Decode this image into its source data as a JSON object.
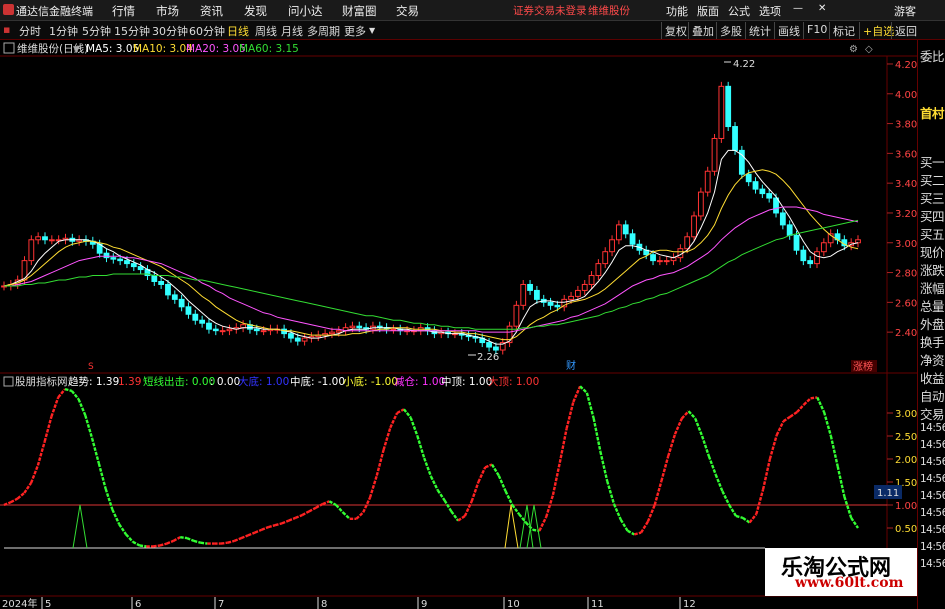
{
  "menubar": {
    "title": "通达信金融终端",
    "items": [
      "行情",
      "市场",
      "资讯",
      "发现",
      "问小达",
      "财富圈",
      "交易"
    ],
    "notice": "证券交易未登录",
    "stock": "维维股份",
    "right": [
      "功能",
      "版面",
      "公式",
      "选项"
    ],
    "user": "游客"
  },
  "toolbar": {
    "periods": [
      "分时",
      "1分钟",
      "5分钟",
      "15分钟",
      "30分钟",
      "60分钟",
      "日线",
      "周线",
      "月线",
      "多周期",
      "更多"
    ],
    "active_period": "日线",
    "buttons": [
      "复权",
      "叠加",
      "多股",
      "统计",
      "画线",
      "F10",
      "标记",
      "+自选",
      "返回"
    ]
  },
  "main_chart": {
    "stock_title": "维维股份(日线)",
    "ma": [
      {
        "label": "MA5: 3.05",
        "color": "#ffffff"
      },
      {
        "label": "MA10: 3.04",
        "color": "#ffdd33"
      },
      {
        "label": "MA20: 3.05",
        "color": "#ff55ff"
      },
      {
        "label": "MA60: 3.15",
        "color": "#33dd33"
      }
    ],
    "high_label": "4.22",
    "low_label": "2.26",
    "markers": [
      {
        "text": "S",
        "color": "#ff3333"
      },
      {
        "text": "财",
        "color": "#3399ff"
      },
      {
        "text": "涨榜",
        "color": "#ff5555"
      }
    ]
  },
  "indicator": {
    "name": "股朋指标网",
    "fields": [
      {
        "label": "趋势: 1.39",
        "color": "#ffffff"
      },
      {
        "label": "1.39",
        "color": "#ff3333"
      },
      {
        "label": "短线出击: 0.00",
        "color": "#33ff33"
      },
      {
        "label": ": 0.00",
        "color": "#ffffff"
      },
      {
        "label": "大底: 1.00",
        "color": "#3333ff"
      },
      {
        "label": "中底: -1.00",
        "color": "#ffffff"
      },
      {
        "label": "小底: -1.00",
        "color": "#ffff33"
      },
      {
        "label": "减仓: 1.00",
        "color": "#ff33ff"
      },
      {
        "label": "中顶: 1.00",
        "color": "#ffffff"
      },
      {
        "label": "大顶: 1.00",
        "color": "#ff3333"
      }
    ],
    "current_value": "1.11"
  },
  "date_axis": {
    "year_label": "2024年",
    "months": [
      "5",
      "6",
      "7",
      "8",
      "9",
      "10",
      "11",
      "12"
    ]
  },
  "sidebar": {
    "labels": [
      "委比",
      "首村",
      "买一",
      "买二",
      "买三",
      "买四",
      "买五",
      "现价",
      "涨跌",
      "涨幅",
      "总量",
      "外盘",
      "换手",
      "净资",
      "收益",
      "自动",
      "交易",
      "14:56",
      "14:56",
      "14:56",
      "14:56",
      "14:56",
      "14:56",
      "14:56",
      "14:56",
      "14:56"
    ]
  },
  "watermark": {
    "line1": "乐淘公式网",
    "line2": "www.60lt.com"
  },
  "chart_data": [
    {
      "type": "candlestick",
      "title": "维维股份(日线)",
      "ylim": [
        2.2,
        4.3
      ],
      "y_ticks": [
        4.2,
        4.0,
        3.8,
        3.6,
        3.4,
        3.2,
        3.0,
        2.8,
        2.6,
        2.4
      ],
      "y_tick_labels": [
        "4.20",
        "4.00",
        "3.80",
        "3.60",
        "3.40",
        "3.20",
        "3.00",
        "2.80",
        "2.60",
        "2.40"
      ],
      "close": [
        2.71,
        2.72,
        2.75,
        2.88,
        3.02,
        3.04,
        3.02,
        3.02,
        3.02,
        3.03,
        3.01,
        3.02,
        3.01,
        2.99,
        2.93,
        2.9,
        2.89,
        2.88,
        2.86,
        2.84,
        2.82,
        2.78,
        2.74,
        2.72,
        2.65,
        2.62,
        2.57,
        2.52,
        2.48,
        2.46,
        2.42,
        2.41,
        2.41,
        2.42,
        2.43,
        2.45,
        2.42,
        2.41,
        2.41,
        2.42,
        2.42,
        2.39,
        2.36,
        2.34,
        2.36,
        2.37,
        2.38,
        2.39,
        2.4,
        2.41,
        2.43,
        2.44,
        2.43,
        2.42,
        2.44,
        2.43,
        2.42,
        2.42,
        2.41,
        2.41,
        2.41,
        2.43,
        2.41,
        2.39,
        2.4,
        2.39,
        2.39,
        2.38,
        2.37,
        2.36,
        2.33,
        2.3,
        2.28,
        2.33,
        2.44,
        2.58,
        2.72,
        2.68,
        2.62,
        2.6,
        2.58,
        2.57,
        2.62,
        2.64,
        2.68,
        2.72,
        2.78,
        2.86,
        2.94,
        3.02,
        3.12,
        3.06,
        2.99,
        2.95,
        2.92,
        2.88,
        2.88,
        2.88,
        2.9,
        2.96,
        3.04,
        3.18,
        3.34,
        3.48,
        3.7,
        4.05,
        3.78,
        3.62,
        3.46,
        3.41,
        3.36,
        3.33,
        3.3,
        3.2,
        3.12,
        3.05,
        2.95,
        2.88,
        2.86,
        2.94,
        3.0,
        3.06,
        3.02,
        2.98,
        3.0,
        3.02
      ],
      "ma5": [
        2.71,
        2.72,
        2.74,
        2.76,
        2.81,
        2.88,
        2.93,
        2.97,
        3.01,
        3.02,
        3.02,
        3.02,
        3.02,
        3.01,
        2.99,
        2.96,
        2.94,
        2.91,
        2.89,
        2.87,
        2.85,
        2.82,
        2.8,
        2.77,
        2.74,
        2.7,
        2.66,
        2.61,
        2.57,
        2.53,
        2.49,
        2.46,
        2.44,
        2.43,
        2.42,
        2.43,
        2.43,
        2.43,
        2.42,
        2.42,
        2.42,
        2.41,
        2.4,
        2.38,
        2.37,
        2.36,
        2.36,
        2.37,
        2.38,
        2.39,
        2.41,
        2.42,
        2.42,
        2.42,
        2.43,
        2.43,
        2.43,
        2.43,
        2.42,
        2.42,
        2.41,
        2.41,
        2.41,
        2.4,
        2.4,
        2.39,
        2.39,
        2.39,
        2.38,
        2.37,
        2.36,
        2.34,
        2.32,
        2.32,
        2.34,
        2.4,
        2.49,
        2.57,
        2.6,
        2.61,
        2.61,
        2.6,
        2.6,
        2.61,
        2.62,
        2.64,
        2.69,
        2.74,
        2.8,
        2.87,
        2.95,
        2.98,
        2.98,
        2.97,
        2.95,
        2.94,
        2.92,
        2.91,
        2.9,
        2.92,
        2.95,
        3.01,
        3.1,
        3.2,
        3.34,
        3.56,
        3.62,
        3.62,
        3.59,
        3.54,
        3.47,
        3.41,
        3.36,
        3.31,
        3.24,
        3.17,
        3.09,
        3.01,
        2.94,
        2.91,
        2.9,
        2.91,
        2.94,
        2.96,
        2.99,
        3.0
      ],
      "ma10": [
        2.71,
        2.72,
        2.73,
        2.75,
        2.78,
        2.82,
        2.86,
        2.9,
        2.94,
        2.97,
        2.99,
        3.0,
        3.01,
        3.01,
        3.0,
        2.99,
        2.97,
        2.96,
        2.94,
        2.92,
        2.9,
        2.88,
        2.86,
        2.84,
        2.81,
        2.78,
        2.75,
        2.72,
        2.68,
        2.64,
        2.61,
        2.57,
        2.54,
        2.51,
        2.48,
        2.46,
        2.45,
        2.44,
        2.43,
        2.42,
        2.42,
        2.41,
        2.41,
        2.4,
        2.39,
        2.38,
        2.38,
        2.38,
        2.38,
        2.38,
        2.38,
        2.39,
        2.39,
        2.4,
        2.41,
        2.42,
        2.42,
        2.43,
        2.43,
        2.43,
        2.42,
        2.42,
        2.42,
        2.42,
        2.41,
        2.41,
        2.4,
        2.4,
        2.39,
        2.39,
        2.38,
        2.37,
        2.36,
        2.35,
        2.35,
        2.37,
        2.41,
        2.45,
        2.48,
        2.5,
        2.53,
        2.55,
        2.58,
        2.6,
        2.61,
        2.62,
        2.64,
        2.66,
        2.69,
        2.73,
        2.77,
        2.81,
        2.85,
        2.89,
        2.91,
        2.94,
        2.95,
        2.95,
        2.94,
        2.94,
        2.94,
        2.96,
        3.0,
        3.05,
        3.12,
        3.23,
        3.32,
        3.39,
        3.44,
        3.47,
        3.48,
        3.49,
        3.48,
        3.46,
        3.42,
        3.37,
        3.31,
        3.25,
        3.19,
        3.14,
        3.09,
        3.05,
        3.02,
        2.99,
        2.97,
        2.96
      ],
      "ma20": [
        2.71,
        2.71,
        2.72,
        2.73,
        2.74,
        2.76,
        2.78,
        2.8,
        2.82,
        2.84,
        2.86,
        2.88,
        2.89,
        2.9,
        2.91,
        2.91,
        2.91,
        2.91,
        2.9,
        2.9,
        2.89,
        2.88,
        2.87,
        2.86,
        2.84,
        2.82,
        2.8,
        2.78,
        2.76,
        2.73,
        2.71,
        2.68,
        2.66,
        2.63,
        2.61,
        2.59,
        2.57,
        2.55,
        2.53,
        2.52,
        2.5,
        2.49,
        2.48,
        2.47,
        2.46,
        2.45,
        2.44,
        2.43,
        2.42,
        2.42,
        2.41,
        2.41,
        2.41,
        2.41,
        2.41,
        2.41,
        2.41,
        2.41,
        2.41,
        2.41,
        2.41,
        2.41,
        2.41,
        2.41,
        2.41,
        2.41,
        2.41,
        2.41,
        2.41,
        2.41,
        2.4,
        2.4,
        2.4,
        2.4,
        2.4,
        2.41,
        2.42,
        2.43,
        2.44,
        2.45,
        2.46,
        2.47,
        2.48,
        2.5,
        2.51,
        2.53,
        2.55,
        2.57,
        2.59,
        2.62,
        2.65,
        2.68,
        2.71,
        2.73,
        2.75,
        2.76,
        2.78,
        2.79,
        2.8,
        2.82,
        2.84,
        2.87,
        2.9,
        2.93,
        2.97,
        3.02,
        3.06,
        3.1,
        3.13,
        3.16,
        3.18,
        3.2,
        3.22,
        3.23,
        3.24,
        3.24,
        3.24,
        3.23,
        3.22,
        3.21,
        3.19,
        3.18,
        3.17,
        3.16,
        3.15,
        3.14
      ],
      "ma60": [
        2.71,
        2.71,
        2.71,
        2.72,
        2.72,
        2.73,
        2.73,
        2.74,
        2.75,
        2.75,
        2.76,
        2.77,
        2.77,
        2.78,
        2.78,
        2.78,
        2.79,
        2.79,
        2.79,
        2.79,
        2.79,
        2.79,
        2.78,
        2.78,
        2.78,
        2.77,
        2.77,
        2.76,
        2.75,
        2.75,
        2.74,
        2.73,
        2.72,
        2.71,
        2.7,
        2.69,
        2.68,
        2.67,
        2.66,
        2.65,
        2.64,
        2.63,
        2.62,
        2.61,
        2.6,
        2.59,
        2.58,
        2.57,
        2.56,
        2.55,
        2.54,
        2.53,
        2.52,
        2.51,
        2.51,
        2.5,
        2.49,
        2.48,
        2.48,
        2.47,
        2.46,
        2.46,
        2.45,
        2.45,
        2.44,
        2.44,
        2.43,
        2.43,
        2.43,
        2.42,
        2.42,
        2.42,
        2.42,
        2.42,
        2.42,
        2.42,
        2.43,
        2.43,
        2.44,
        2.44,
        2.45,
        2.45,
        2.46,
        2.47,
        2.48,
        2.49,
        2.5,
        2.51,
        2.53,
        2.54,
        2.56,
        2.57,
        2.59,
        2.6,
        2.62,
        2.63,
        2.65,
        2.66,
        2.68,
        2.7,
        2.72,
        2.74,
        2.76,
        2.78,
        2.81,
        2.84,
        2.87,
        2.89,
        2.92,
        2.94,
        2.96,
        2.98,
        3.0,
        3.02,
        3.03,
        3.05,
        3.06,
        3.07,
        3.08,
        3.09,
        3.1,
        3.11,
        3.12,
        3.13,
        3.14,
        3.15
      ]
    },
    {
      "type": "line",
      "title": "股朋指标网",
      "ylim": [
        -0.3,
        3.8
      ],
      "y_ticks": [
        3.0,
        2.5,
        2.0,
        1.5,
        1.0,
        0.5
      ],
      "y_tick_labels": [
        "3.00",
        "2.50",
        "2.00",
        "1.50",
        "1.00",
        "0.50"
      ],
      "baseline": 1.0,
      "trend": [
        1.0,
        1.06,
        1.14,
        1.26,
        1.48,
        1.86,
        2.38,
        2.92,
        3.34,
        3.52,
        3.48,
        3.3,
        2.95,
        2.45,
        1.9,
        1.35,
        0.9,
        0.58,
        0.36,
        0.2,
        0.12,
        0.1,
        0.1,
        0.12,
        0.16,
        0.22,
        0.3,
        0.28,
        0.22,
        0.18,
        0.16,
        0.16,
        0.16,
        0.18,
        0.22,
        0.28,
        0.34,
        0.4,
        0.46,
        0.52,
        0.56,
        0.6,
        0.66,
        0.72,
        0.78,
        0.86,
        0.94,
        1.02,
        1.08,
        1.0,
        0.84,
        0.7,
        0.7,
        0.84,
        1.16,
        1.64,
        2.2,
        2.68,
        3.0,
        3.08,
        2.9,
        2.5,
        2.02,
        1.62,
        1.32,
        1.1,
        0.86,
        0.66,
        0.76,
        1.08,
        1.5,
        1.82,
        1.88,
        1.64,
        1.3,
        1.0,
        0.8,
        0.62,
        0.46,
        0.44,
        0.74,
        1.22,
        1.92,
        2.66,
        3.24,
        3.58,
        3.44,
        2.88,
        2.16,
        1.52,
        1.02,
        0.68,
        0.44,
        0.36,
        0.4,
        0.64,
        1.0,
        1.52,
        2.06,
        2.54,
        2.88,
        3.04,
        2.88,
        2.5,
        2.06,
        1.66,
        1.3,
        1.0,
        0.76,
        0.72,
        0.62,
        0.8,
        1.34,
        2.0,
        2.52,
        2.82,
        2.92,
        3.02,
        3.18,
        3.32,
        3.34,
        3.02,
        2.5,
        1.84,
        1.18,
        0.72,
        0.5
      ]
    }
  ]
}
